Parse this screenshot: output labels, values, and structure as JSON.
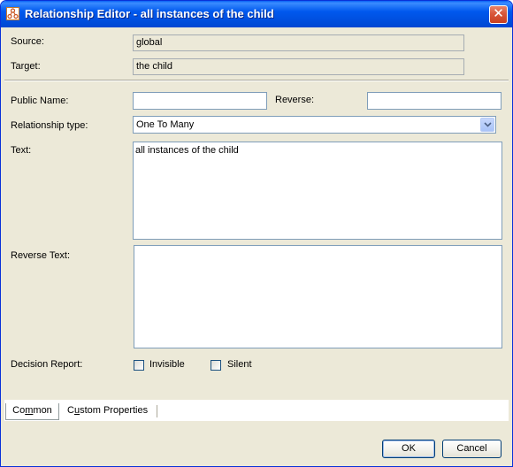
{
  "window": {
    "title": "Relationship Editor - all instances of the child",
    "close_glyph": "✕"
  },
  "form": {
    "source_label": "Source:",
    "source_value": "global",
    "target_label": "Target:",
    "target_value": "the child",
    "public_name_label": "Public Name:",
    "public_name_value": "",
    "reverse_label": "Reverse:",
    "reverse_value": "",
    "relationship_type_label": "Relationship type:",
    "relationship_type_value": "One To Many",
    "text_label": "Text:",
    "text_value": "all instances of the child",
    "reverse_text_label": "Reverse Text:",
    "reverse_text_value": "",
    "decision_report_label": "Decision Report:",
    "invisible_label": "Invisible",
    "invisible_checked": false,
    "silent_label": "Silent",
    "silent_checked": false
  },
  "tabs": [
    {
      "label_pre": "Co",
      "label_u": "m",
      "label_post": "mon",
      "active": true
    },
    {
      "label_pre": "C",
      "label_u": "u",
      "label_post": "stom Properties",
      "active": false
    }
  ],
  "buttons": {
    "ok_label": "OK",
    "cancel_label": "Cancel"
  },
  "icons": {
    "title_icon": "relationship-app-icon",
    "dropdown": "chevron-down-icon",
    "close": "close-icon"
  }
}
